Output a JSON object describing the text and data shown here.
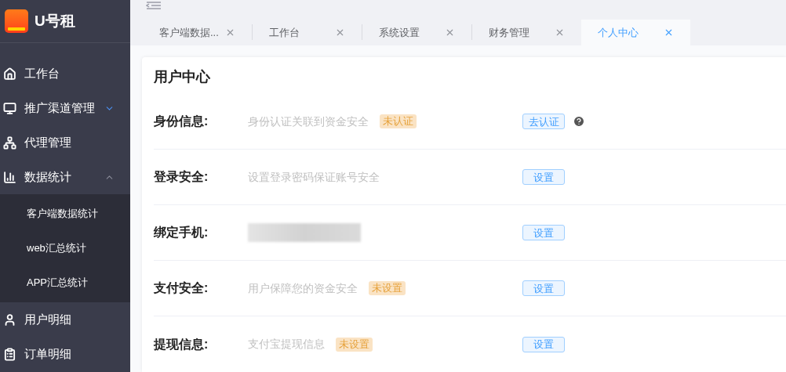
{
  "logo": {
    "title": "U号租"
  },
  "sidebar": {
    "items": [
      {
        "label": "工作台"
      },
      {
        "label": "推广渠道管理",
        "expanded": false
      },
      {
        "label": "代理管理"
      },
      {
        "label": "数据统计",
        "expanded": true,
        "children": [
          {
            "label": "客户端数据统计"
          },
          {
            "label": "web汇总统计"
          },
          {
            "label": "APP汇总统计"
          }
        ]
      },
      {
        "label": "用户明细"
      },
      {
        "label": "订单明细"
      }
    ]
  },
  "tabs": [
    {
      "label": "客户端数据...",
      "selected": false
    },
    {
      "label": "工作台",
      "selected": false
    },
    {
      "label": "系统设置",
      "selected": false
    },
    {
      "label": "财务管理",
      "selected": false
    },
    {
      "label": "个人中心",
      "selected": true
    }
  ],
  "card": {
    "title": "用户中心",
    "rows": [
      {
        "kind": "text",
        "label": "身份信息:",
        "description": "身份认证关联到资金安全",
        "badge": "未认证",
        "button": "去认证",
        "help": true
      },
      {
        "kind": "text",
        "label": "登录安全:",
        "description": "设置登录密码保证账号安全",
        "button": "设置",
        "help": false
      },
      {
        "kind": "blurred",
        "label": "绑定手机:",
        "button": "设置",
        "help": false
      },
      {
        "kind": "text",
        "label": "支付安全:",
        "description": "用户保障您的资金安全",
        "badge": "未设置",
        "button": "设置",
        "help": false
      },
      {
        "kind": "text",
        "label": "提现信息:",
        "description": "支付宝提现信息",
        "badge": "未设置",
        "button": "设置",
        "help": false
      }
    ]
  }
}
